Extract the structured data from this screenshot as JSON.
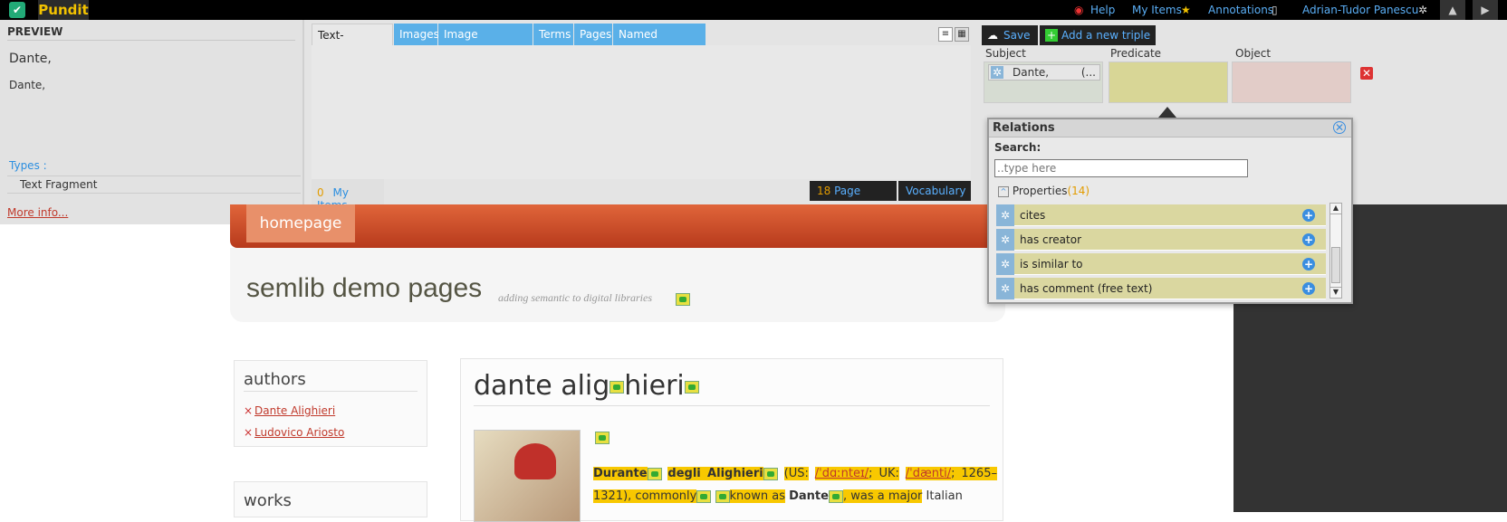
{
  "topbar": {
    "brand": "Pundit",
    "help": "Help",
    "my_items": "My Items",
    "annotations": "Annotations",
    "user": "Adrian-Tudor Panescu"
  },
  "preview": {
    "title": "PREVIEW",
    "heading": "Dante,",
    "text": "Dante,",
    "types_label": "Types :",
    "type_value": "Text Fragment",
    "more_info": "More info..."
  },
  "tabs": [
    "Text-fragment",
    "Images",
    "Image Fragments",
    "Terms",
    "Pages",
    "Named Content"
  ],
  "list": {
    "my_items_count": "0",
    "my_items_label": "My Items",
    "page_items_count": "18",
    "page_items_label": "Page Items",
    "vocabulary": "Vocabulary"
  },
  "triple": {
    "save": "Save",
    "add": "Add a new triple",
    "subject_label": "Subject",
    "predicate_label": "Predicate",
    "object_label": "Object",
    "subject_value": "Dante,",
    "subject_more": "(..."
  },
  "relations": {
    "title": "Relations",
    "search_label": "Search:",
    "search_placeholder": "..type here",
    "properties_label": "Properties",
    "properties_count": "(14)",
    "items": [
      "cites",
      "has creator",
      "is similar to",
      "has comment (free text)"
    ]
  },
  "site": {
    "homepage": "homepage",
    "title": "semlib demo pages",
    "tagline": "adding semantic to digital libraries",
    "authors_title": "authors",
    "authors": [
      "Dante Alighieri",
      "Ludovico Ariosto"
    ],
    "works_title": "works",
    "article_title_a": "dante alig",
    "article_title_b": "hieri"
  },
  "article": {
    "w1": "Durante",
    "w2": "degli Alighieri",
    "us": "(US:",
    "ipa_us": "/ˈdɑːnteɪ/",
    "uk": "; UK:",
    "ipa_uk": "/ˈdænti/",
    "dates": "; 1265–",
    "line2a": "1321), commonly",
    "known": "known as",
    "dante": "Dante",
    ",": ",",
    "major": ", was a major",
    "italian": "Italian"
  }
}
